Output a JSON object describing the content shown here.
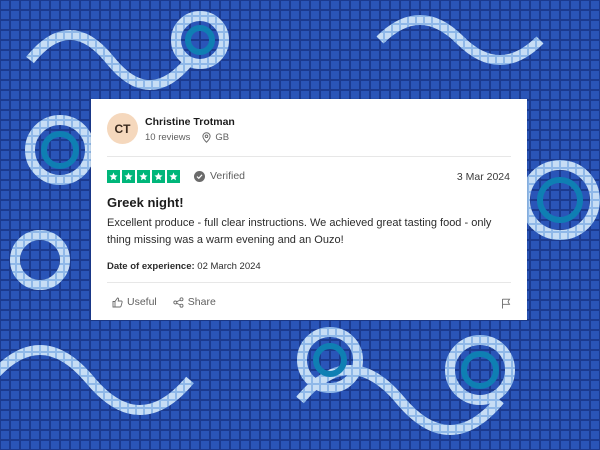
{
  "review": {
    "avatar_initials": "CT",
    "reviewer_name": "Christine Trotman",
    "review_count": "10 reviews",
    "location": "GB",
    "rating": 5,
    "verified_label": "Verified",
    "date": "3 Mar 2024",
    "title": "Greek night!",
    "body": "Excellent produce - full clear instructions. We achieved great tasting food - only thing missing was a warm evening and an Ouzo!",
    "experience_label": "Date of experience:",
    "experience_date": "02 March 2024",
    "useful_label": "Useful",
    "share_label": "Share"
  },
  "colors": {
    "star_green": "#00b67a",
    "avatar_bg": "#f5d8bd",
    "background_blue": "#1e3f9a"
  }
}
